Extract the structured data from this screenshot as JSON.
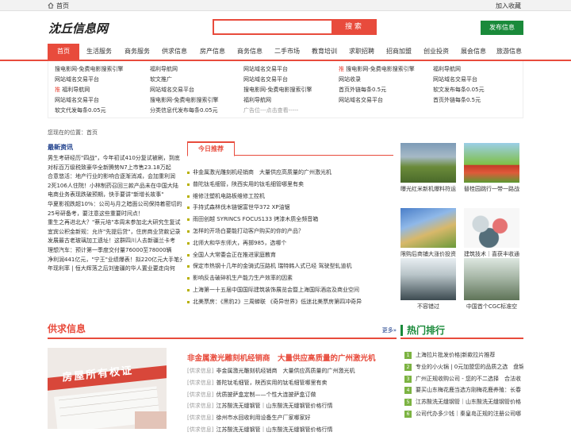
{
  "topbar": {
    "home": "首页",
    "favorite": "加入收藏"
  },
  "logo": "沈丘信息网",
  "search": {
    "placeholder": "",
    "button": "搜 索"
  },
  "publish_button": "发布信息",
  "nav": [
    "首页",
    "生活服务",
    "商务服务",
    "供求信息",
    "房产信息",
    "商务信息",
    "二手市场",
    "教育培训",
    "求职招聘",
    "招商加盟",
    "创业投资",
    "展会信息",
    "旅游信息"
  ],
  "subnav": {
    "col1": [
      {
        "tag": "",
        "text": "搜电影网-免费电影搜索引擎"
      },
      {
        "tag": "",
        "text": "网站域名交易平台"
      },
      {
        "tag": "推",
        "text": "福利导航网"
      },
      {
        "tag": "",
        "text": "网站域名交易平台"
      },
      {
        "tag": "",
        "text": "软文代发每条0.05元"
      }
    ],
    "col2": [
      {
        "tag": "",
        "text": "福利导航网"
      },
      {
        "tag": "",
        "text": "软文推广"
      },
      {
        "tag": "",
        "text": "网站域名交易平台"
      },
      {
        "tag": "",
        "text": "搜电影网-免费电影搜索引擎"
      },
      {
        "tag": "",
        "text": "分类信息代发布每条0.05元"
      }
    ],
    "col3": [
      {
        "tag": "",
        "text": "网站域名交易平台"
      },
      {
        "tag": "",
        "text": "网站域名交易平台"
      },
      {
        "tag": "",
        "text": "搜电影网-免费电影搜索引擎"
      },
      {
        "tag": "",
        "text": "福利导航网"
      },
      {
        "tag": "",
        "text": "广告位---点击查看-----"
      }
    ],
    "col4": [
      {
        "tag": "推",
        "text": "搜电影网-免费电影搜索引擎"
      },
      {
        "tag": "",
        "text": "网站收录"
      },
      {
        "tag": "",
        "text": "首页外链每条0.5元"
      },
      {
        "tag": "",
        "text": "网站域名交易平台"
      }
    ],
    "col5": [
      {
        "tag": "",
        "text": "福利导航网"
      },
      {
        "tag": "",
        "text": "网站域名交易平台"
      },
      {
        "tag": "",
        "text": "软文发布每条0.05元"
      },
      {
        "tag": "",
        "text": "首页外链每条0.5元"
      }
    ]
  },
  "breadcrumb": "您现在的位置：首页",
  "latest": {
    "title": "最新资讯",
    "lines": [
      "男生考研经历\"四战\"，今年初试410分复试被刷，到底",
      "对标百万级税致豪华全新腾势N7上市售23.18万起",
      "合意悠活：地产行业的影响合逐渐消减，会加重利润",
      "2死106人住院！小林制药召回三款产品未在中国大陆",
      "电商业务表现跌破预期，快手要讲\"新增长故事\"",
      "华夏影视跌超10%：公司与月之暗面公司保持着密切的",
      "25号研备考，要注意这些重要时间点！",
      "重生之再进北大？\"蔡元培\"本周末参加北大研究生复试",
      "宜宾公积金新规：允许\"先提后贷\"，住房商业贷款记录",
      "发展最古老玻璃加工遗址！这群四川人去新疆兰卡考",
      "理想汽车：预计第一季度交付量76000至78000辆",
      "净利润441亿元，\"宁王\"业绩爆表！拟220亿元大手笔分",
      "年现利率 | 恒大辉落之后刘鉴疆的华人置业要走向何"
    ]
  },
  "recommend": {
    "tab": "今日推荐",
    "items": [
      "非金属激光雕刻机经销商　大量供应高质量的广州激光机",
      "普陀钛毛细管，陕西实用的钛毛细管哪里有卖",
      "维修注塑机电路板维修工控机",
      "手持式森林伐木链锯富世华372 XP油锯",
      "雨田创越 SYRINCS FOCUS133 烤漆木质全频音箱",
      "怎样的开场白要能打动客户购买的你的产品？",
      "北师大和华东师大，再掷985，选哪个",
      "全国人大常委会正在推进家庭教育",
      "保定市热钢十几年的金骑式压路机 瑞特韩人式已经 驾驶型轧道机",
      "影响反击破碎机生产能力生产效率的因素",
      "上海第一十五届中国国际建筑装饰展览会暨上海国际酒店及商业空间",
      "北美票房：《黑豹2》三周蝉联 《奇异世界》低迷北美票房第四冲奇异"
    ]
  },
  "thumbs": [
    {
      "caption": "曝光红米新机爆料符运"
    },
    {
      "caption": "替桂园跳行一带一路战"
    },
    {
      "caption": "限购后商铺大涨价投资"
    },
    {
      "caption": "建筑技术｜喜获丰收通"
    },
    {
      "caption": "不容错过"
    },
    {
      "caption": "中国首个CGC标准空"
    }
  ],
  "gongqiu": {
    "title": "供求信息",
    "more": "更多»",
    "img_text": "房屋所有权证",
    "headline": "非金属激光雕刻机经销商　大量供应高质量的广州激光机",
    "items": [
      {
        "cat": "[供求信息]",
        "text": "非金属激光雕刻机经销商　大量供应高质量的广州激光机"
      },
      {
        "cat": "[供求信息]",
        "text": "普陀钛毛细管，陕西实用的钛毛细管哪里有卖"
      },
      {
        "cat": "[供求信息]",
        "text": "优质披萨盒定制——个性大连披萨盒订做"
      },
      {
        "cat": "[供求信息]",
        "text": "江苏酸洗无缝钢管｜山东酸洗无缝钢管价格行情"
      },
      {
        "cat": "[供求信息]",
        "text": "徐州市水回收利用设备生产厂家哪家好"
      },
      {
        "cat": "[供求信息]",
        "text": "江苏酸洗无缝钢管｜山东酸洗无缝钢管价格行情"
      }
    ]
  },
  "hot": {
    "title": "热门排行",
    "items": [
      {
        "n": "1",
        "text": "上海拉片批发价格|新款拉片推荐"
      },
      {
        "n": "2",
        "text": "专业的小火锅 | 0元加盟您的品质之选　盘锦"
      },
      {
        "n": "3",
        "text": "广州正规收购公司 - 您的不二选择　合法收"
      },
      {
        "n": "4",
        "text": "要买山东梅花鹿当选方刚梅花鹿养殖：长春"
      },
      {
        "n": "5",
        "text": "江苏酸洗无缝钢管｜山东酸洗无缝钢管价格"
      },
      {
        "n": "6",
        "text": "公司代办多少钱｜秦皇岛正规的注册公司哪"
      }
    ]
  },
  "colors": {
    "accent": "#e84b3c",
    "green": "#1a8a3a",
    "link_blue": "#1a3c8a"
  }
}
